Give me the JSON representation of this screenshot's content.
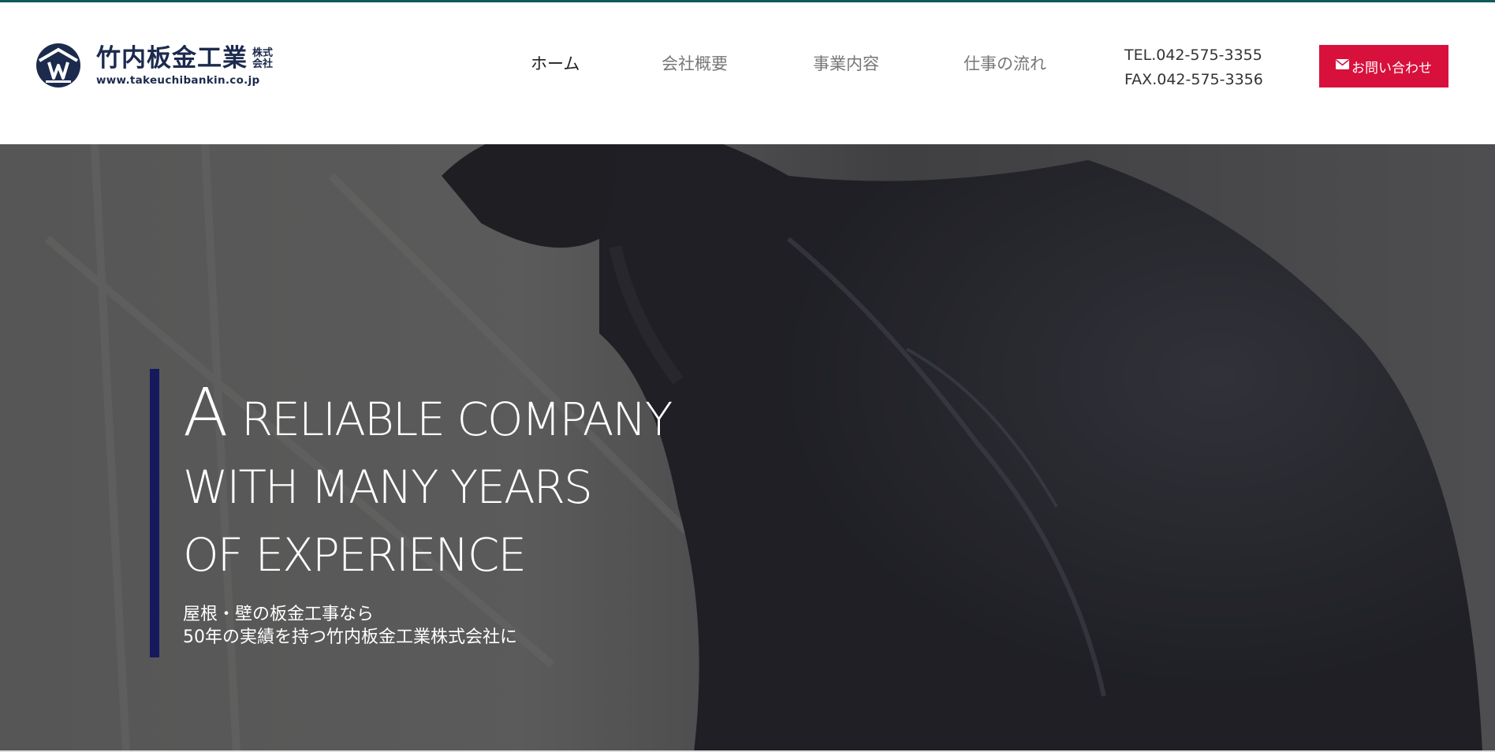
{
  "header": {
    "logo": {
      "name": "竹内板金工業",
      "suffix_top": "株式",
      "suffix_bottom": "会社",
      "url": "www.takeuchibankin.co.jp",
      "icon": "company-crest-icon",
      "color": "#1c2b4d"
    },
    "nav": [
      {
        "label": "ホーム",
        "active": true
      },
      {
        "label": "会社概要",
        "active": false
      },
      {
        "label": "事業内容",
        "active": false
      },
      {
        "label": "仕事の流れ",
        "active": false
      }
    ],
    "contact": {
      "tel": "TEL.042-575-3355",
      "fax": "FAX.042-575-3356"
    },
    "inquiry_button": {
      "label": "お問い合わせ",
      "icon": "mail-icon",
      "color": "#d8103c"
    }
  },
  "hero": {
    "headline_first_letter": "A",
    "headline_line1_rest": " RELIABLE COMPANY",
    "headline_line2": "WITH MANY YEARS",
    "headline_line3": "OF EXPERIENCE",
    "subtext_line1": "屋根・壁の板金工事なら",
    "subtext_line2": "50年の実績を持つ竹内板金工業株式会社に",
    "accent_color": "#15195e"
  }
}
